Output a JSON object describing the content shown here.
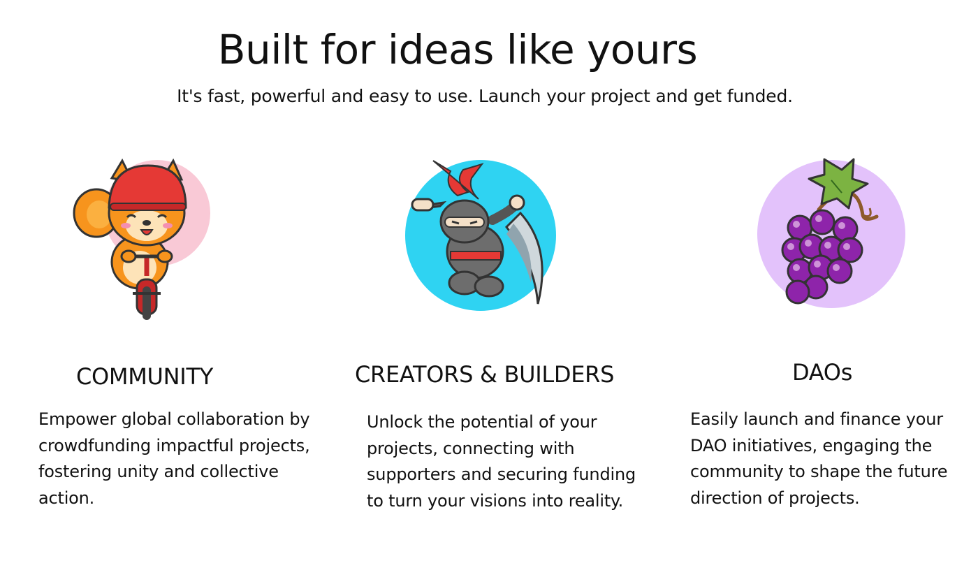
{
  "header": {
    "title": "Built for ideas like yours",
    "subtitle": "It's fast, powerful and easy to use. Launch your project and get funded."
  },
  "cards": [
    {
      "illustration": "squirrel-riding-bicycle-icon",
      "circle_color": "#f9c9d6",
      "title": "COMMUNITY",
      "description": "Empower global collaboration by crowdfunding impactful projects, fostering unity and collective action."
    },
    {
      "illustration": "ninja-with-sword-icon",
      "circle_color": "#2fd3f2",
      "title": "CREATORS & BUILDERS",
      "description": "Unlock the potential of your projects,  connecting with supporters and securing funding to turn your visions into reality."
    },
    {
      "illustration": "grapes-icon",
      "circle_color": "#e3c2fb",
      "title": "DAOs",
      "description": "Easily launch and finance your DAO initiatives, engaging the community to shape the future direction of projects."
    }
  ]
}
